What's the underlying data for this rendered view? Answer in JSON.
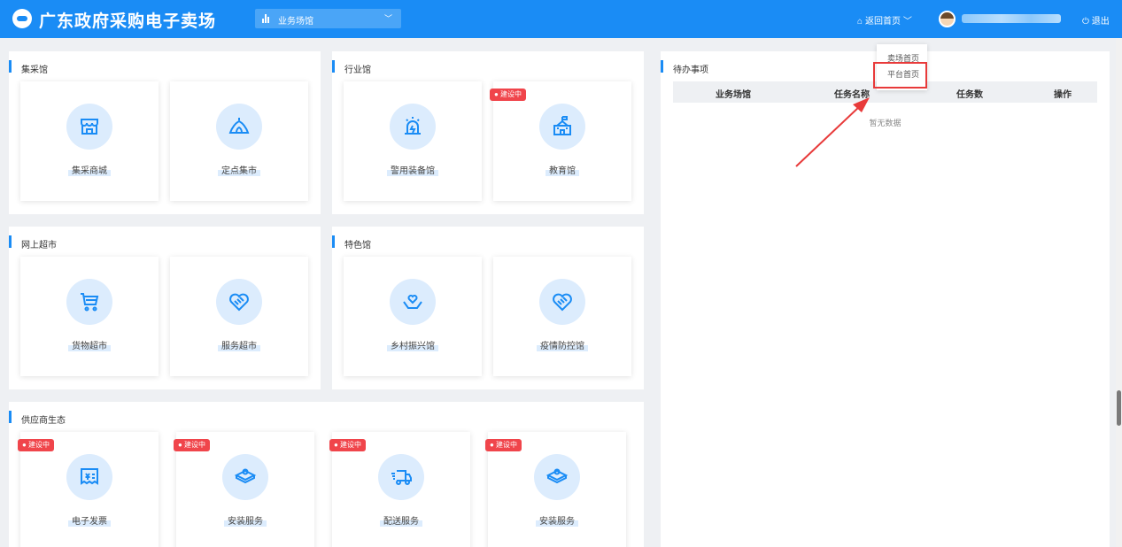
{
  "header": {
    "brand": "广东政府采购电子卖场",
    "hall_select": "业务场馆",
    "home_link": "返回首页",
    "logout": "退出"
  },
  "dropdown": {
    "item1": "卖场首页",
    "item2": "平台首页"
  },
  "sections": {
    "jicai": {
      "title": "集采馆",
      "cards": [
        "集采商城",
        "定点集市"
      ]
    },
    "hangye": {
      "title": "行业馆",
      "cards": [
        "警用装备馆",
        "教育馆"
      ]
    },
    "wangshang": {
      "title": "网上超市",
      "cards": [
        "货物超市",
        "服务超市"
      ]
    },
    "tese": {
      "title": "特色馆",
      "cards": [
        "乡村振兴馆",
        "疫情防控馆"
      ]
    },
    "gongying": {
      "title": "供应商生态",
      "cards": [
        "电子发票",
        "安装服务",
        "配送服务",
        "安装服务"
      ]
    }
  },
  "badge": "● 建设中",
  "todo": {
    "title": "待办事项",
    "columns": [
      "业务场馆",
      "任务名称",
      "任务数",
      "操作"
    ],
    "empty": "暂无数据"
  },
  "colors": {
    "primary": "#1a8cf5",
    "badge": "#f0454b",
    "highlight": "#e83a3a"
  }
}
